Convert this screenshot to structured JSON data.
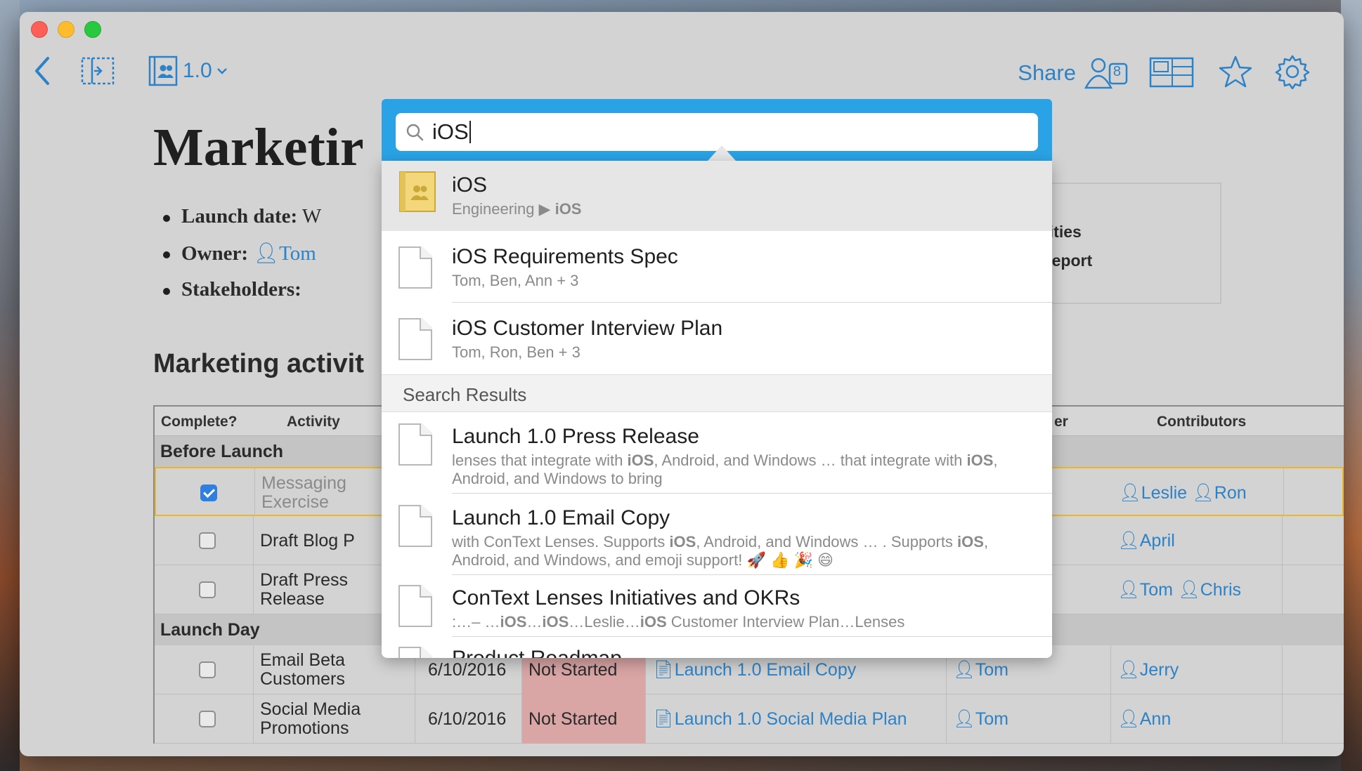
{
  "toolbar": {
    "version": "1.0",
    "share_label": "Share",
    "share_count": "8"
  },
  "document": {
    "title": "Marketir",
    "bullets": [
      {
        "label": "Launch date:",
        "value": "W"
      },
      {
        "label": "Owner:",
        "value": "Tom"
      },
      {
        "label": "Stakeholders:",
        "value": ""
      }
    ],
    "section_heading": "Marketing activit",
    "side_box": [
      "vities",
      "Report"
    ]
  },
  "table": {
    "headers": {
      "complete": "Complete?",
      "activity": "Activity",
      "owner_partial": "er",
      "contributors": "Contributors"
    },
    "groups": {
      "before": "Before Launch",
      "launch": "Launch Day"
    },
    "before_rows": [
      {
        "checked": true,
        "activity": "Messaging Exercise",
        "contributors": [
          "Leslie",
          "Ron"
        ]
      },
      {
        "checked": false,
        "activity": "Draft Blog P",
        "contributors": [
          "April"
        ]
      },
      {
        "checked": false,
        "activity": "Draft Press Release",
        "contributors": [
          "Tom",
          "Chris"
        ]
      }
    ],
    "launch_rows": [
      {
        "checked": false,
        "activity": "Email Beta Customers",
        "date": "6/10/2016",
        "status": "Not Started",
        "doc": "Launch 1.0 Email Copy",
        "owner": "Tom",
        "contributors": [
          "Jerry"
        ]
      },
      {
        "checked": false,
        "activity": "Social Media Promotions",
        "date": "6/10/2016",
        "status": "Not Started",
        "doc": "Launch 1.0 Social Media Plan",
        "owner": "Tom",
        "contributors": [
          "Ann"
        ]
      }
    ]
  },
  "search": {
    "query": "iOS",
    "top_results": [
      {
        "title": "iOS",
        "sub": "Engineering ▶ iOS",
        "kind": "folder"
      },
      {
        "title": "iOS Requirements Spec",
        "sub": "Tom, Ben, Ann + 3",
        "kind": "doc"
      },
      {
        "title": "iOS Customer Interview Plan",
        "sub": "Tom, Ron, Ben + 3",
        "kind": "doc"
      }
    ],
    "section_label": "Search Results",
    "results": [
      {
        "title": "Launch 1.0 Press Release",
        "sub": "lenses that integrate with iOS, Android, and Windows … that integrate with iOS, Android, and Windows to bring"
      },
      {
        "title": "Launch 1.0 Email Copy",
        "sub": "with ConText Lenses. Supports iOS, Android, and Windows … . Supports iOS, Android, and Windows, and emoji support! 🚀 👍 🎉 😄"
      },
      {
        "title": "ConText Lenses Initiatives and OKRs",
        "sub": ":…– …iOS…iOS…Leslie…iOS Customer Interview Plan…Lenses"
      },
      {
        "title": "Product Roadmap",
        "sub": ""
      }
    ]
  },
  "colors": {
    "accent": "#2d82c6",
    "search_header": "#2aa3e6",
    "status_not_started": "#d9a5a5"
  }
}
